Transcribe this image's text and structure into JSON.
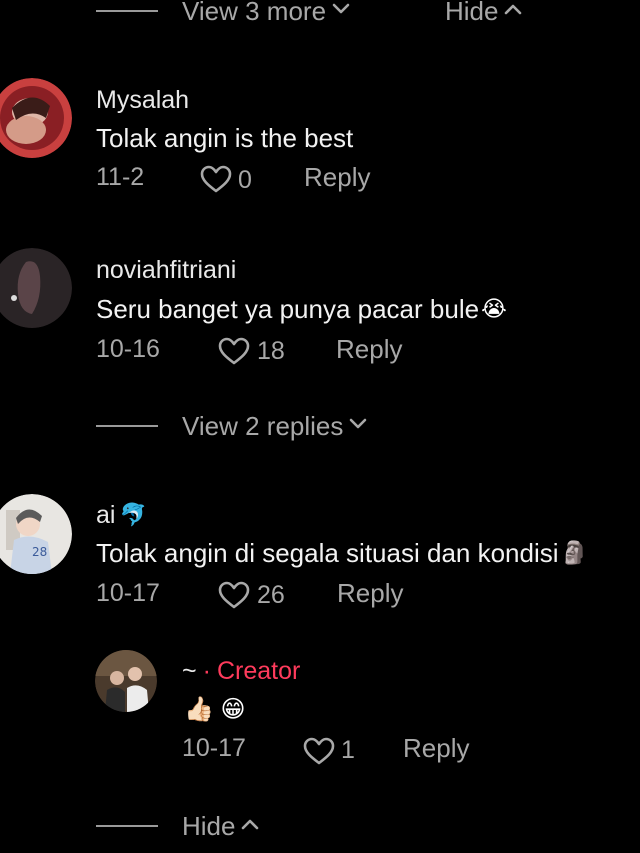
{
  "top": {
    "view_more": "View 3 more",
    "hide": "Hide"
  },
  "comments": [
    {
      "username": "Mysalah",
      "text": "Tolak angin is the best",
      "date": "11-2",
      "likes": "0",
      "reply": "Reply"
    },
    {
      "username": "noviahfitriani",
      "text": "Seru banget ya punya pacar bule",
      "emoji": "😭",
      "date": "10-16",
      "likes": "18",
      "reply": "Reply",
      "view_replies": "View 2 replies"
    },
    {
      "username": "ai",
      "badge_emoji": "🐬",
      "text": "Tolak angin di segala situasi dan kondisi",
      "emoji": "🗿",
      "date": "10-17",
      "likes": "26",
      "reply": "Reply"
    }
  ],
  "nested_reply": {
    "username": "~",
    "separator": "·",
    "role": "Creator",
    "text_emoji": "👍🏻 😁",
    "date": "10-17",
    "likes": "1",
    "reply": "Reply"
  },
  "bottom": {
    "hide": "Hide"
  },
  "colors": {
    "background": "#000000",
    "muted": "#a8a8a8",
    "creator": "#ff3b5c"
  }
}
